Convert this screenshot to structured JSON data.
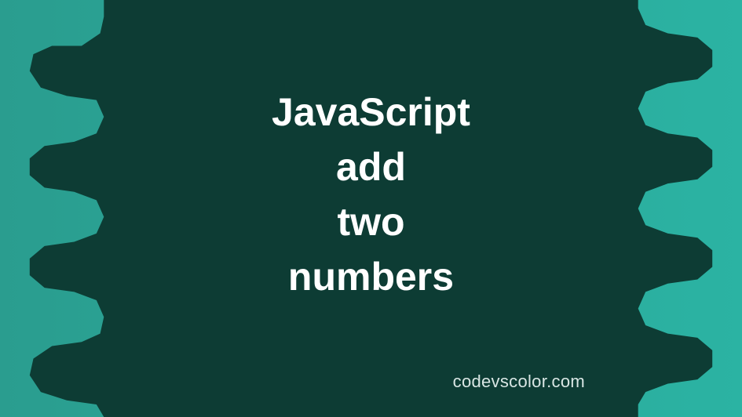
{
  "title": {
    "line1": "JavaScript",
    "line2": "add",
    "line3": "two",
    "line4": "numbers"
  },
  "watermark": "codevscolor.com",
  "colors": {
    "background_light": "#2bb3a3",
    "background_dark": "#0d3c34",
    "text": "#ffffff"
  }
}
